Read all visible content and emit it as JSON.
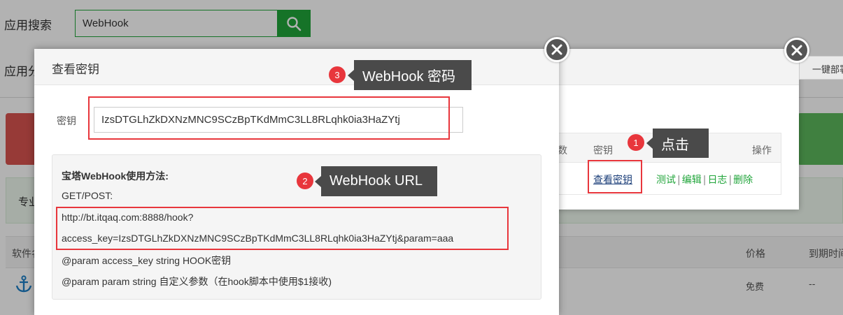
{
  "background": {
    "search_label": "应用搜索",
    "search_value": "WebHook",
    "category_label": "应用分",
    "pro_text": "专业",
    "table_header_software": "软件名",
    "table_header_price": "价格",
    "table_header_expire": "到期时间",
    "row_price": "免费",
    "row_expire": "--"
  },
  "webhook_list_dialog": {
    "right_button": "一键部署",
    "col_count": "数",
    "col_key": "密钥",
    "col_ops": "操作",
    "view_key_link": "查看密钥",
    "ops": {
      "test": "测试",
      "edit": "编辑",
      "log": "日志",
      "delete": "删除"
    }
  },
  "key_dialog": {
    "title": "查看密钥",
    "key_label": "密钥",
    "key_value": "IzsDTGLhZkDXNzMNC9SCzBpTKdMmC3LL8RLqhk0ia3HaZYtj",
    "usage": {
      "title": "宝塔WebHook使用方法:",
      "method": "GET/POST:",
      "url_line1": "http://bt.itqaq.com:8888/hook?",
      "url_line2": "access_key=IzsDTGLhZkDXNzMNC9SCzBpTKdMmC3LL8RLqhk0ia3HaZYtj&param=aaa",
      "param1": "@param access_key string HOOK密钥",
      "param2": "@param param string 自定义参数（在hook脚本中使用$1接收)"
    }
  },
  "annotations": [
    {
      "number": "1",
      "text": "点击"
    },
    {
      "number": "2",
      "text": "WebHook URL"
    },
    {
      "number": "3",
      "text": "WebHook 密码"
    }
  ],
  "colors": {
    "accent_green": "#20a53a",
    "annotation_red": "#e8363c",
    "tooltip_bg": "#4a4a4a"
  }
}
